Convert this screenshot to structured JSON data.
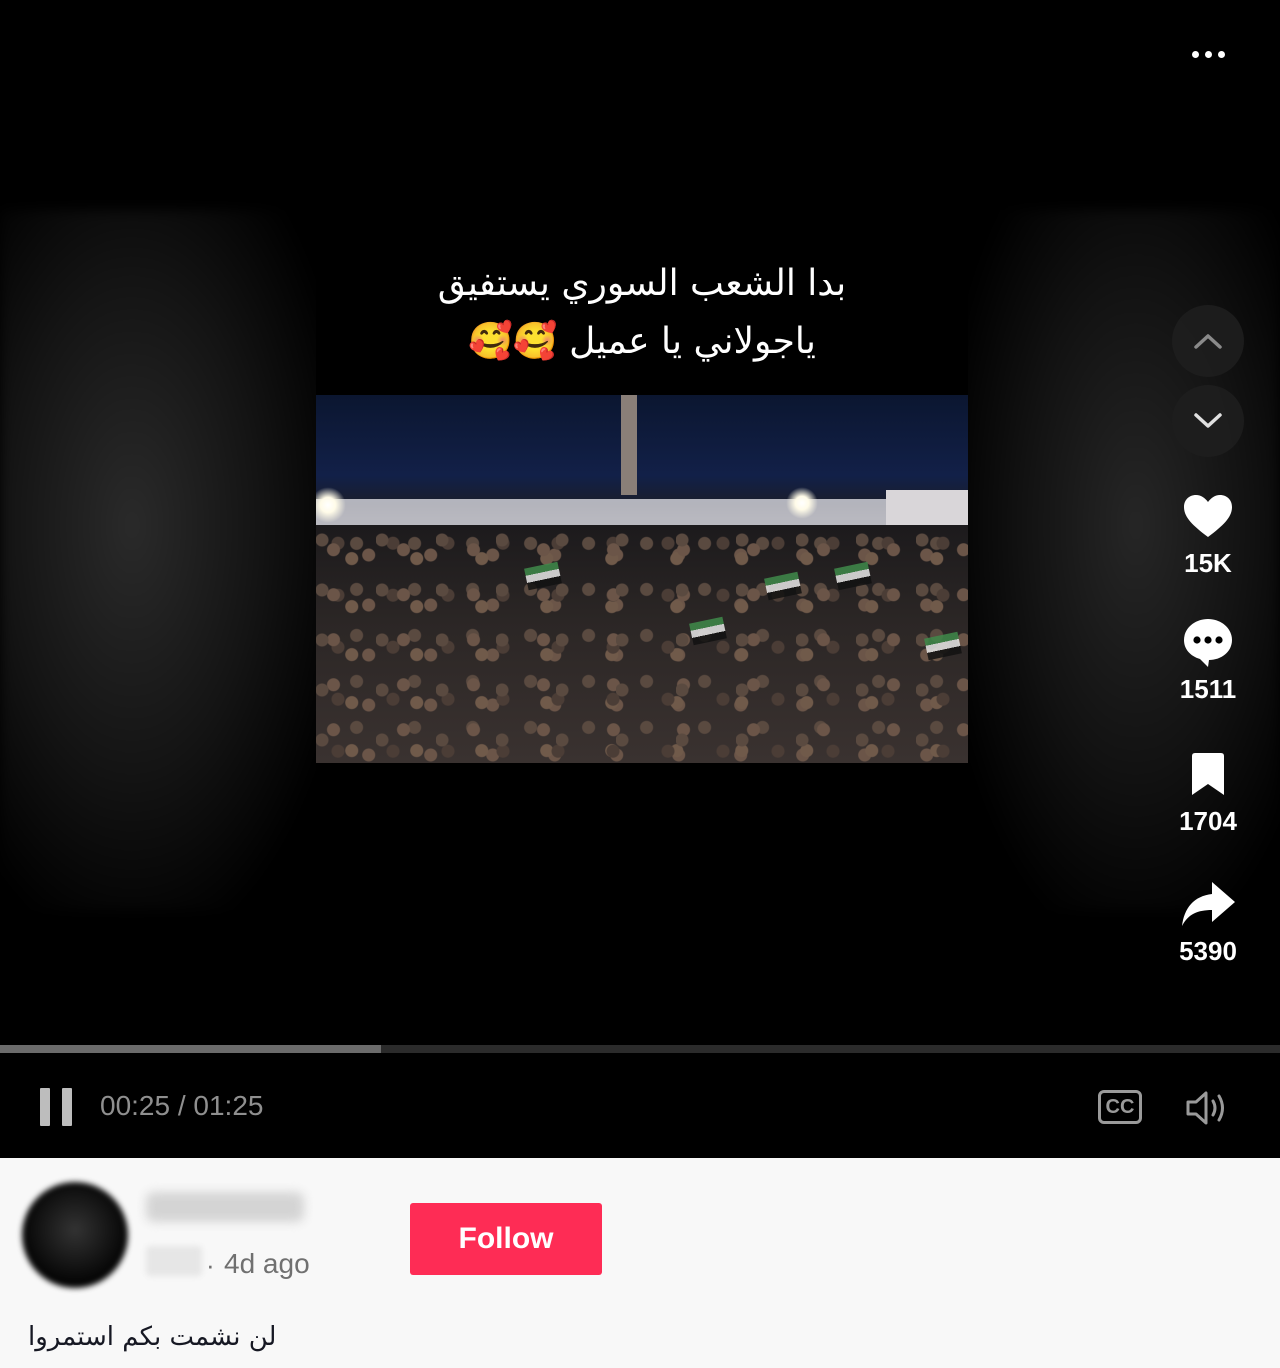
{
  "video": {
    "caption_line1": "بدا الشعب السوري يستفيق",
    "caption_line2": "ياجولاني يا عميل 🥰🥰",
    "progress": 0.298
  },
  "actions": {
    "likes": "15K",
    "comments": "1511",
    "saves": "1704",
    "shares": "5390"
  },
  "player": {
    "time_display": "00:25 / 01:25",
    "cc_label": "CC"
  },
  "post": {
    "dot": "·",
    "time_ago": "4d ago",
    "follow_label": "Follow",
    "description": "لن نشمت بكم استمروا"
  },
  "colors": {
    "follow_bg": "#fe2c55",
    "video_bg": "#000000",
    "info_bg": "#f8f8f8"
  },
  "icons": [
    "more-icon",
    "chevron-up-icon",
    "chevron-down-icon",
    "heart-icon",
    "comment-icon",
    "bookmark-icon",
    "share-icon",
    "pause-icon",
    "cc-icon",
    "volume-icon"
  ]
}
